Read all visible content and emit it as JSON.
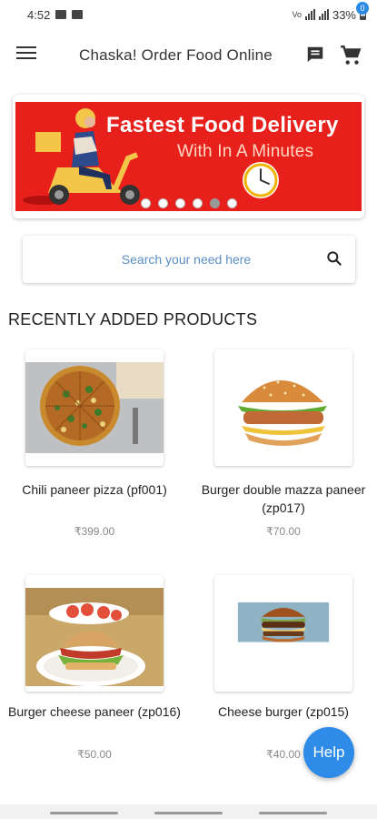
{
  "status_bar": {
    "time": "4:52",
    "battery": "33%",
    "icons": [
      "image-icon",
      "news-icon",
      "volte-icon",
      "wifi-icon",
      "signal-icon",
      "battery-icon"
    ]
  },
  "app_bar": {
    "title": "Chaska! Order Food Online",
    "icons": [
      "menu-icon",
      "chat-icon",
      "cart-icon"
    ],
    "cart_count": "0"
  },
  "banner": {
    "headline": "Fastest Food Delivery",
    "subline": "With In A Minutes",
    "colors": {
      "background": "#e8201c",
      "headline": "#ffffff",
      "subline": "#ffd7c2"
    },
    "slide_count": 6,
    "active_slide": 5
  },
  "search": {
    "placeholder": "Search your need here",
    "value": ""
  },
  "section_title": "RECENTLY ADDED PRODUCTS",
  "products": [
    {
      "name": "Chili paneer pizza (pf001)",
      "price": "₹399.00"
    },
    {
      "name": "Burger double mazza paneer (zp017)",
      "price": "₹70.00"
    },
    {
      "name": "Burger cheese paneer (zp016)",
      "price": "₹50.00"
    },
    {
      "name": "Cheese burger (zp015)",
      "price": "₹40.00"
    }
  ],
  "help_button": {
    "label": "Help",
    "color": "#2e8be8"
  }
}
